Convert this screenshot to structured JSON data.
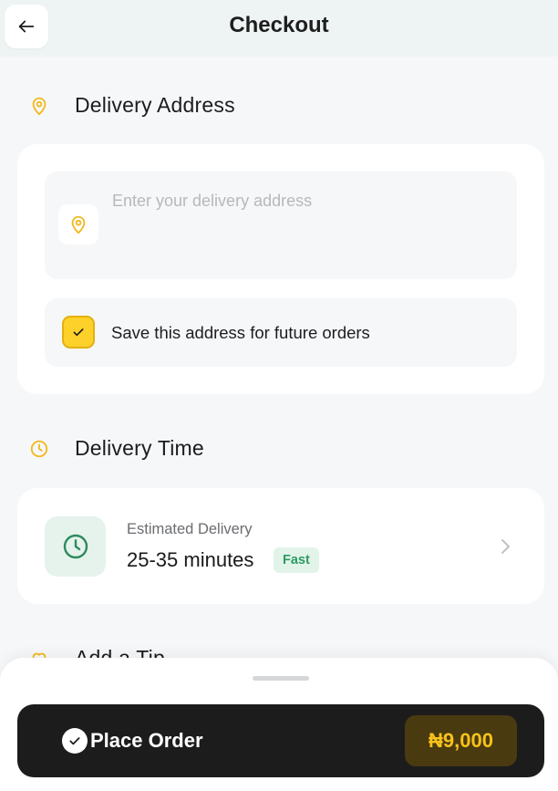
{
  "header": {
    "title": "Checkout",
    "back_icon": "arrow-left-icon"
  },
  "delivery_address": {
    "heading": "Delivery Address",
    "heading_icon": "map-pin-icon",
    "input_placeholder": "Enter your delivery address",
    "input_value": "",
    "input_icon": "map-pin-icon",
    "save_checkbox": {
      "label": "Save this address for future orders",
      "checked": true
    }
  },
  "delivery_time": {
    "heading": "Delivery Time",
    "heading_icon": "clock-icon",
    "estimate_label": "Estimated Delivery",
    "estimate_value": "25-35 minutes",
    "badge": "Fast"
  },
  "tip": {
    "heading": "Add a Tip",
    "heading_icon": "heart-icon"
  },
  "place_order": {
    "label": "Place Order",
    "price": "₦9,000"
  },
  "colors": {
    "accent_yellow": "#fdd02a",
    "accent_green": "#2f9a63",
    "button_dark": "#1c1c1c",
    "price_text": "#f7c21a"
  }
}
